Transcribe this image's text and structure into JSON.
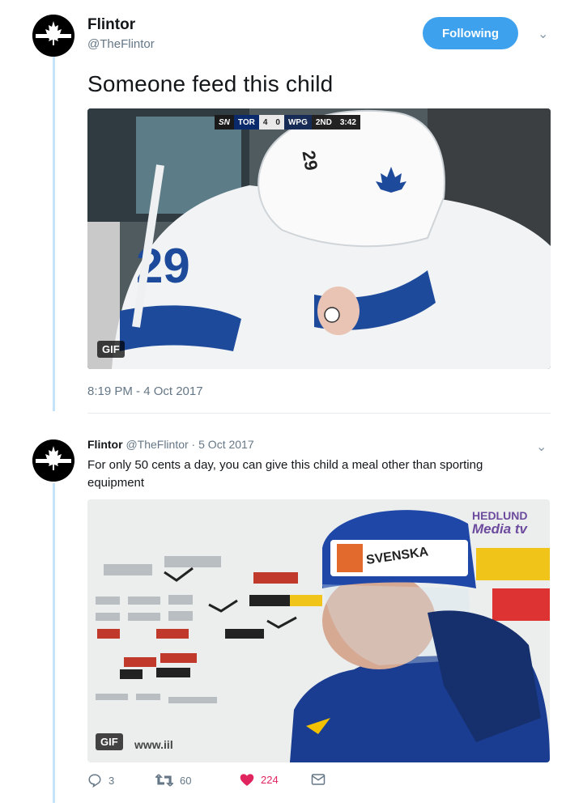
{
  "tweet1": {
    "display_name": "Flintor",
    "handle": "@TheFlintor",
    "follow_label": "Following",
    "text": "Someone feed this child",
    "media": {
      "badge": "GIF",
      "scorebug": {
        "network": "SN",
        "team_a": "TOR",
        "score_a": "4",
        "score_b": "0",
        "team_b": "WPG",
        "period": "2ND",
        "clock": "3:42"
      }
    },
    "timestamp": "8:19 PM - 4 Oct 2017"
  },
  "tweet2": {
    "display_name": "Flintor",
    "handle": "@TheFlintor",
    "separator": " · ",
    "date": "5 Oct 2017",
    "text": "For only 50 cents a day, you can give this child a meal other than sporting equipment",
    "media": {
      "badge": "GIF",
      "url_text": "www.iil"
    },
    "counts": {
      "replies": "3",
      "retweets": "60",
      "likes": "224"
    }
  },
  "colors": {
    "accent": "#3ea1ee",
    "thread_line": "#c4e3f8",
    "like": "#e0245e",
    "secondary_text": "#657786"
  },
  "icons": {
    "avatar": "maple-leaf-logo",
    "caret": "chevron-down-icon",
    "reply": "reply-icon",
    "retweet": "retweet-icon",
    "like": "heart-icon",
    "dm": "envelope-icon"
  }
}
